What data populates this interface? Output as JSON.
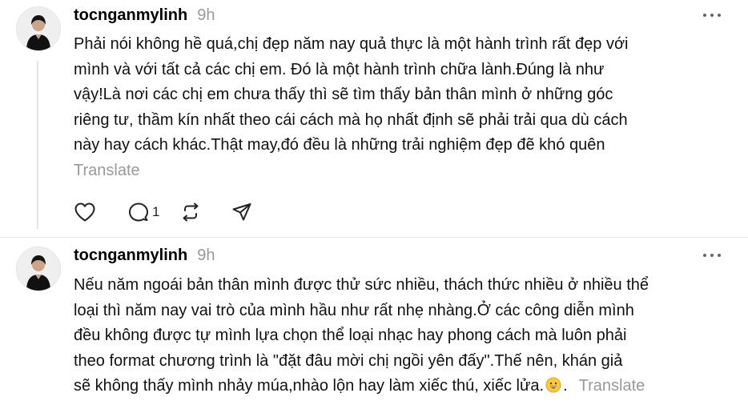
{
  "posts": [
    {
      "username": "tocnganmylinh",
      "time": "9h",
      "lines": [
        "Phải nói không hề quá,chị đẹp năm nay quả thực là một hành trình rất đẹp với",
        "mình và với tất cả các chị em. Đó là một hành trình chữa lành.Đúng là như",
        "vậy!Là nơi các chị em chưa thấy thì sẽ tìm thấy bản thân mình ở những góc",
        "riêng tư, thầm kín nhất theo cái cách mà họ nhất định sẽ phải trải qua dù cách",
        "này hay cách khác.Thật may,đó đều là những trải nghiệm đẹp đẽ khó quên"
      ],
      "translate": "Translate",
      "actions": {
        "like_icon": "heart-icon",
        "reply_icon": "speech-bubble-icon",
        "reply_count": "1",
        "repost_icon": "repost-icon",
        "share_icon": "paper-plane-icon"
      }
    },
    {
      "username": "tocnganmylinh",
      "time": "9h",
      "lines": [
        "Nếu năm ngoái bản thân mình được thử sức nhiều, thách thức nhiều ở nhiều thể",
        "loại thì năm nay vai trò của mình hầu như rất nhẹ nhàng.Ở các công diễn mình",
        "đều không được tự mình lựa chọn thể loại nhạc hay phong cách mà luôn phải",
        "theo format chương trình là \"đặt đâu mời chị ngồi yên đấy\".Thế nên, khán giả",
        "sẽ không thấy mình nhảy múa,nhào lộn hay làm xiếc thú, xiếc lửa."
      ],
      "trailing_text": ".",
      "emoji_icon": "grinning-face-emoji-icon",
      "translate": "Translate"
    }
  ],
  "more_icon": "more-dots-icon",
  "colors": {
    "muted": "#999999",
    "divider": "#e6e6e6",
    "thread_line": "#e3e3e3"
  }
}
